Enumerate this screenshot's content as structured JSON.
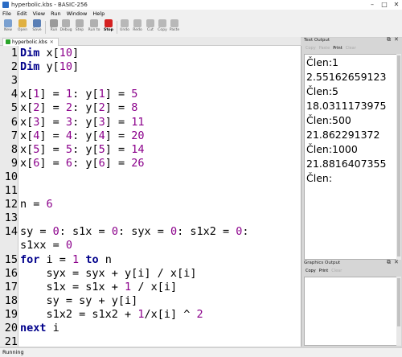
{
  "window": {
    "title": "hyperbolic.kbs - BASIC-256",
    "controls": [
      "–",
      "□",
      "✕"
    ]
  },
  "menu": [
    "File",
    "Edit",
    "View",
    "Run",
    "Window",
    "Help"
  ],
  "toolbar": [
    {
      "label": "New",
      "icon": "new-file-icon",
      "color": "#7aa0d0"
    },
    {
      "label": "Open",
      "icon": "open-folder-icon",
      "color": "#e0b040"
    },
    {
      "label": "Save",
      "icon": "save-icon",
      "color": "#5a7fb5"
    },
    {
      "label": "Run",
      "icon": "run-icon",
      "color": "#9a9a9a"
    },
    {
      "label": "Debug",
      "icon": "debug-icon",
      "color": "#b0b0b0"
    },
    {
      "label": "Step",
      "icon": "step-icon",
      "color": "#b0b0b0"
    },
    {
      "label": "Run to",
      "icon": "run-to-icon",
      "color": "#b0b0b0"
    },
    {
      "label": "Stop",
      "icon": "stop-icon",
      "color": "#d42020"
    },
    {
      "label": "Undo",
      "icon": "undo-icon",
      "color": "#b8b8b8"
    },
    {
      "label": "Redo",
      "icon": "redo-icon",
      "color": "#b8b8b8"
    },
    {
      "label": "Cut",
      "icon": "cut-icon",
      "color": "#b8b8b8"
    },
    {
      "label": "Copy",
      "icon": "copy-icon",
      "color": "#b8b8b8"
    },
    {
      "label": "Paste",
      "icon": "paste-icon",
      "color": "#b8b8b8"
    }
  ],
  "tab": {
    "label": "hyperbolic.kbs",
    "close": "✕"
  },
  "editor": {
    "lines": [
      {
        "n": "1",
        "text": "Dim x[10]"
      },
      {
        "n": "2",
        "text": "Dim y[10]"
      },
      {
        "n": "3",
        "text": ""
      },
      {
        "n": "4",
        "text": "x[1] = 1: y[1] = 5"
      },
      {
        "n": "5",
        "text": "x[2] = 2: y[2] = 8"
      },
      {
        "n": "6",
        "text": "x[3] = 3: y[3] = 11"
      },
      {
        "n": "7",
        "text": "x[4] = 4: y[4] = 20"
      },
      {
        "n": "8",
        "text": "x[5] = 5: y[5] = 14"
      },
      {
        "n": "9",
        "text": "x[6] = 6: y[6] = 26"
      },
      {
        "n": "10",
        "text": ""
      },
      {
        "n": "11",
        "text": ""
      },
      {
        "n": "12",
        "text": "n = 6"
      },
      {
        "n": "13",
        "text": ""
      },
      {
        "n": "14",
        "text": "sy = 0: s1x = 0: syx = 0: s1x2 = 0:"
      },
      {
        "n": "",
        "text": "s1xx = 0"
      },
      {
        "n": "15",
        "text": "for i = 1 to n"
      },
      {
        "n": "16",
        "text": "    syx = syx + y[i] / x[i]"
      },
      {
        "n": "17",
        "text": "    s1x = s1x + 1 / x[i]"
      },
      {
        "n": "18",
        "text": "    sy = sy + y[i]"
      },
      {
        "n": "19",
        "text": "    s1x2 = s1x2 + 1/x[i] ^ 2"
      },
      {
        "n": "20",
        "text": "next i"
      },
      {
        "n": "21",
        "text": ""
      }
    ],
    "keywords": [
      "Dim",
      "for",
      "to",
      "next"
    ]
  },
  "text_output": {
    "title": "Text Output",
    "tools": [
      "Copy",
      "Paste",
      "Print",
      "Clear"
    ],
    "lines": [
      "Člen:1",
      "2.55162659123",
      "Člen:5",
      "18.0311173975",
      "Člen:500",
      "21.862291372",
      "Člen:1000",
      "21.8816407355",
      "Člen:"
    ]
  },
  "graphics_output": {
    "title": "Graphics Output",
    "tools": [
      "Copy",
      "Print",
      "Clear"
    ]
  },
  "status": {
    "text": "Running"
  }
}
